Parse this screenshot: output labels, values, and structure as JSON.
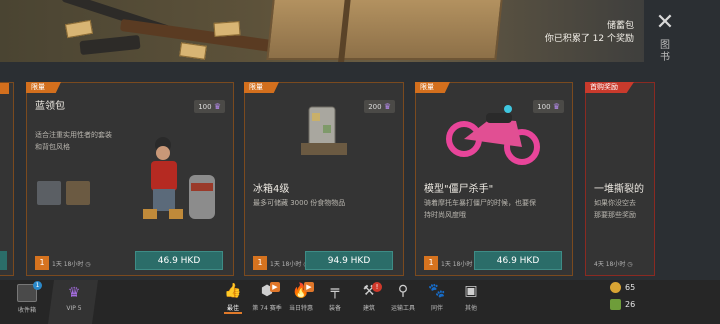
{
  "banner": {
    "title": "储蓄包",
    "subtitle": "你已积累了 12 个奖励"
  },
  "side_label": "图书",
  "cards": [
    {
      "tag": "限量",
      "title": "蓝领包",
      "desc_lines": [
        "适合注重实用性者的套装",
        "和背包风格"
      ],
      "points": "100",
      "qty": "1",
      "timer": "1天 18小时",
      "price": "46.9 HKD"
    },
    {
      "tag": "限量",
      "title": "冰箱4级",
      "desc_lines": [
        "最多可储藏 3000 份食物物品"
      ],
      "points": "200",
      "qty": "1",
      "timer": "1天 18小时",
      "price": "94.9 HKD"
    },
    {
      "tag": "限量",
      "title": "模型\"僵尸杀手\"",
      "desc_lines": [
        "骑着摩托车暴打僵尸的时候，也要保",
        "持时尚风度哦"
      ],
      "points": "100",
      "qty": "1",
      "timer": "1天 18小时",
      "price": "46.9 HKD"
    },
    {
      "tag": "首购奖励",
      "title": "一堆撕裂的",
      "desc_lines": [
        "如果你没空去",
        "那要那些奖励"
      ],
      "timer": "4天 18小时"
    }
  ],
  "bottom": {
    "mailbox_label": "收件箱",
    "mailbox_badge": "1",
    "vip_label": "VIP 5",
    "nav": [
      {
        "label": "最佳",
        "icon": "thumb-icon"
      },
      {
        "label": "第 74 赛季",
        "icon": "season-icon"
      },
      {
        "label": "当日特惠",
        "icon": "fire-icon"
      },
      {
        "label": "装备",
        "icon": "gun-icon"
      },
      {
        "label": "建筑",
        "icon": "tools-icon"
      },
      {
        "label": "运输工具",
        "icon": "motorbike-icon"
      },
      {
        "label": "同伴",
        "icon": "dog-icon"
      },
      {
        "label": "其他",
        "icon": "gift-icon"
      }
    ],
    "currency": [
      {
        "value": "65",
        "icon": "coin-icon",
        "color": "#d8a434"
      },
      {
        "value": "26",
        "icon": "cash-icon",
        "color": "#6e9d3a"
      }
    ]
  }
}
